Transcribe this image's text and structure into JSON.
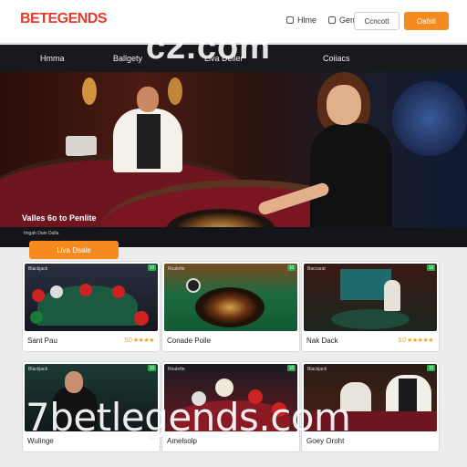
{
  "header": {
    "logo": "BETEGENDS",
    "link1": "Hlme",
    "link2": "Geme",
    "outline_button": "Ccncott",
    "orange_button": "Oafsti"
  },
  "nav": {
    "items": [
      "Hmma",
      "Ballgety",
      "Liva Deller",
      "Coiiacs"
    ],
    "watermark": "c2.com"
  },
  "hero": {
    "caption": "Valles 6o to Penlite",
    "subcaption": "Imgah Dain Dalla"
  },
  "live_button": "Llva Dsale",
  "games": [
    {
      "tag": "Blackjack",
      "title": "Sant Pau",
      "rating": "5.0 ★★★★",
      "badge": "10"
    },
    {
      "tag": "Roulette",
      "title": "Conade Poile",
      "rating": "",
      "badge": "10"
    },
    {
      "tag": "Baccarat",
      "title": "Nak Dack",
      "rating": "5.0 ★★★★★",
      "badge": "10"
    },
    {
      "tag": "Blackjack",
      "title": "Wulinge",
      "rating": "",
      "badge": "10"
    },
    {
      "tag": "Roulette",
      "title": "Amelsolp",
      "rating": "",
      "badge": "10"
    },
    {
      "tag": "Blackjack",
      "title": "Goey Oroht",
      "rating": "",
      "badge": "10"
    }
  ],
  "watermark": "7betlegends.com",
  "colors": {
    "accent": "#f58a1f",
    "nav_bg": "#18191d",
    "badge": "#2ba84a",
    "logo_mark": "#e53b2c"
  }
}
